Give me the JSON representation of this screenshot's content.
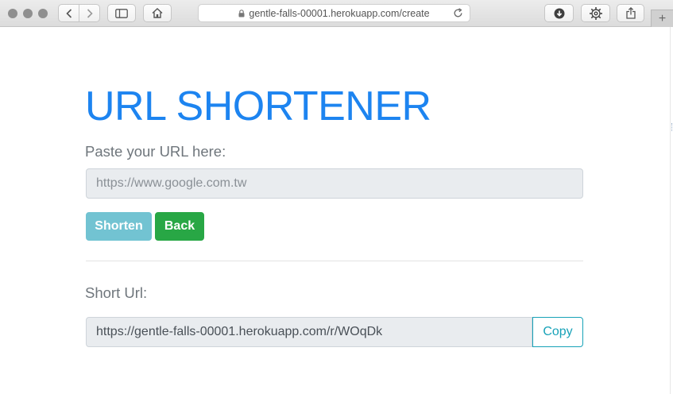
{
  "browser": {
    "url": "gentle-falls-00001.herokuapp.com/create",
    "new_tab_label": "+",
    "icons": [
      "back-icon",
      "forward-icon",
      "sidebar-icon",
      "home-icon",
      "lock-icon",
      "reload-icon",
      "download-icon",
      "gear-icon",
      "share-icon"
    ]
  },
  "page": {
    "title": "URL SHORTENER",
    "url_label": "Paste your URL here:",
    "url_input_placeholder": "https://www.google.com.tw",
    "shorten_button": "Shorten",
    "back_button": "Back",
    "short_url_label": "Short Url:",
    "short_url_value": "https://gentle-falls-00001.herokuapp.com/r/WOqDk",
    "copy_button": "Copy"
  },
  "colors": {
    "title": "#1d84f0",
    "shorten_button": "#72c3d2",
    "back_button": "#28a745",
    "copy_button": "#17a2b8"
  }
}
